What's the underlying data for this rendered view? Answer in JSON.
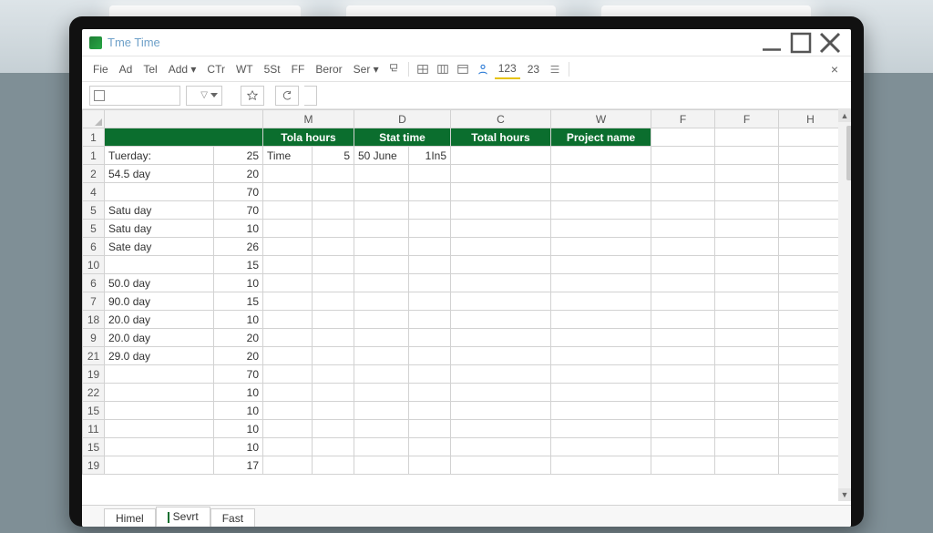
{
  "window": {
    "title": "Tme Time"
  },
  "menu": {
    "items": [
      "Fie",
      "Ad",
      "Tel",
      "Add ▾",
      "CTr",
      "WT",
      "5St",
      "FF",
      "Beror",
      "Ser ▾"
    ],
    "num_label_1": "123",
    "num_label_2": "23"
  },
  "columns": [
    "",
    "",
    "M",
    "D",
    "C",
    "W",
    "F",
    "F",
    "H"
  ],
  "header_row": [
    "",
    "",
    "Tola hours",
    "Stat time",
    "Total hours",
    "Project name",
    "",
    "",
    ""
  ],
  "rows": [
    {
      "n": "1"
    },
    {
      "n": "1",
      "a": "Tuerday:",
      "b": "25",
      "c1": "Time",
      "c2": "5",
      "d1": "50 June",
      "d2": "1In5"
    },
    {
      "n": "2",
      "a": "54.5 day",
      "b": "20"
    },
    {
      "n": "4",
      "a": "",
      "b": "70"
    },
    {
      "n": "5",
      "a": "Satu day",
      "b": "70"
    },
    {
      "n": "5",
      "a": "Satu day",
      "b": "10"
    },
    {
      "n": "6",
      "a": "Sate day",
      "b": "26"
    },
    {
      "n": "10",
      "a": "",
      "b": "15"
    },
    {
      "n": "6",
      "a": "50.0 day",
      "b": "10"
    },
    {
      "n": "7",
      "a": "90.0 day",
      "b": "15"
    },
    {
      "n": "18",
      "a": "20.0 day",
      "b": "10"
    },
    {
      "n": "9",
      "a": "20.0 day",
      "b": "20"
    },
    {
      "n": "21",
      "a": "29.0 day",
      "b": "20"
    },
    {
      "n": "19",
      "a": "",
      "b": "70"
    },
    {
      "n": "22",
      "a": "",
      "b": "10"
    },
    {
      "n": "15",
      "a": "",
      "b": "10"
    },
    {
      "n": "11",
      "a": "",
      "b": "10"
    },
    {
      "n": "15",
      "a": "",
      "b": "10"
    },
    {
      "n": "19",
      "a": "",
      "b": "17"
    }
  ],
  "tabs": [
    {
      "label": "Himel",
      "active": false
    },
    {
      "label": "Sevrt",
      "active": true
    },
    {
      "label": "Fast",
      "active": false
    }
  ]
}
